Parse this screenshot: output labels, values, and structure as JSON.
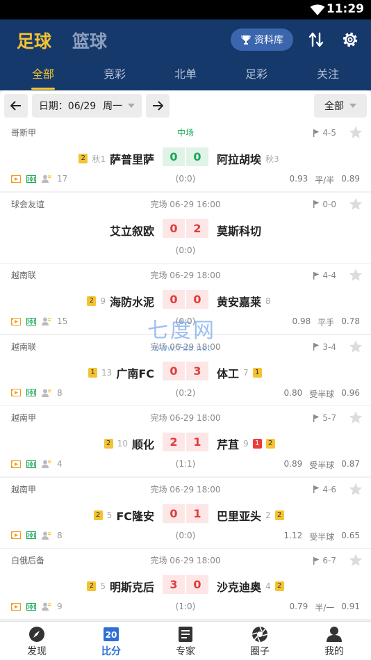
{
  "status_bar": {
    "time": "11:29"
  },
  "header": {
    "sport_tabs": [
      "足球",
      "篮球"
    ],
    "database_label": "资料库",
    "filter_tabs": [
      "全部",
      "竞彩",
      "北单",
      "足彩",
      "关注"
    ]
  },
  "date_bar": {
    "date_label": "日期：06/29",
    "weekday": "周一",
    "scope": "全部"
  },
  "watermark": {
    "title": "七度网",
    "url": "www.7do.net"
  },
  "matches": [
    {
      "league": "哥斯甲",
      "status": "中场",
      "live": true,
      "corners": "4-5",
      "home_badge": "2",
      "home_rank": "秋1",
      "home": "萨普里萨",
      "home_score": "0",
      "away_score": "0",
      "away": "阿拉胡埃",
      "away_rank": "秋3",
      "away_badges": [],
      "half": "(0:0)",
      "comments": "17",
      "odds": [
        "0.93",
        "平/半",
        "0.89"
      ]
    },
    {
      "league": "球会友谊",
      "status": "完场 06-29 16:00",
      "live": false,
      "corners": "0-0",
      "home_badge": "",
      "home_rank": "",
      "home": "艾立叙欧",
      "home_score": "0",
      "away_score": "2",
      "away": "莫斯科切",
      "away_rank": "",
      "away_badges": [],
      "half": "(0:0)",
      "comments": "",
      "odds": []
    },
    {
      "league": "越南联",
      "status": "完场 06-29 18:00",
      "live": false,
      "corners": "4-4",
      "home_badge": "2",
      "home_rank": "9",
      "home": "海防水泥",
      "home_score": "0",
      "away_score": "0",
      "away": "黄安嘉莱",
      "away_rank": "8",
      "away_badges": [],
      "half": "(0:0)",
      "comments": "15",
      "odds": [
        "0.98",
        "平手",
        "0.78"
      ]
    },
    {
      "league": "越南联",
      "status": "完场 06-29 18:00",
      "live": false,
      "corners": "3-4",
      "home_badge": "1",
      "home_rank": "13",
      "home": "广南FC",
      "home_score": "0",
      "away_score": "3",
      "away": "体工",
      "away_rank": "7",
      "away_badges": [
        "1"
      ],
      "half": "(0:2)",
      "comments": "8",
      "odds": [
        "0.80",
        "受半球",
        "0.96"
      ]
    },
    {
      "league": "越南甲",
      "status": "完场 06-29 18:00",
      "live": false,
      "corners": "5-7",
      "home_badge": "2",
      "home_rank": "10",
      "home": "顺化",
      "home_score": "2",
      "away_score": "1",
      "away": "芹苴",
      "away_rank": "9",
      "away_badges": [
        "1",
        "2"
      ],
      "half": "(1:1)",
      "comments": "4",
      "odds": [
        "0.89",
        "受半球",
        "0.87"
      ]
    },
    {
      "league": "越南甲",
      "status": "完场 06-29 18:00",
      "live": false,
      "corners": "4-6",
      "home_badge": "2",
      "home_rank": "5",
      "home": "FC隆安",
      "home_score": "0",
      "away_score": "1",
      "away": "巴里亚头",
      "away_rank": "2",
      "away_badges": [
        "2"
      ],
      "half": "(0:0)",
      "comments": "8",
      "odds": [
        "1.12",
        "受半球",
        "0.65"
      ]
    },
    {
      "league": "白俄后备",
      "status": "完场 06-29 18:00",
      "live": false,
      "corners": "6-7",
      "home_badge": "2",
      "home_rank": "5",
      "home": "明斯克后",
      "home_score": "3",
      "away_score": "0",
      "away": "沙克迪奥",
      "away_rank": "4",
      "away_badges": [
        "2"
      ],
      "half": "(1:0)",
      "comments": "9",
      "odds": [
        "0.79",
        "半/一",
        "0.91"
      ]
    }
  ],
  "bottom_nav": [
    "发现",
    "比分",
    "专家",
    "圈子",
    "我的"
  ],
  "bottom_nav_active": 1,
  "score_icon_text": "20"
}
